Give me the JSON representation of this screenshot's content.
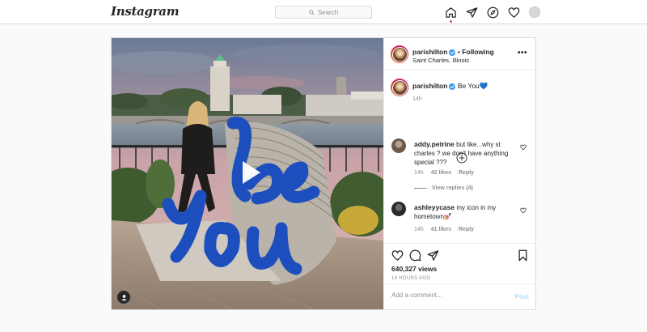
{
  "nav": {
    "logo": "Instagram",
    "search_placeholder": "Search",
    "icons": [
      "home-icon",
      "direct-icon",
      "explore-icon",
      "activity-heart-icon",
      "profile-avatar"
    ]
  },
  "post": {
    "username": "parishilton",
    "separator": "•",
    "follow_status": "Following",
    "location": "Saint Charles, Illinois",
    "more": "•••",
    "caption_text": "Be You",
    "caption_emoji": "💙",
    "caption_time": "14h",
    "comments": [
      {
        "username": "addy.petrine",
        "text": "but like...why st charles ? we don't have anything special ???",
        "time": "14h",
        "likes": "42 likes",
        "reply": "Reply",
        "view_replies": "View replies (4)"
      },
      {
        "username": "ashleyycase",
        "text": "my icon in my hometown",
        "emoji": "💅🏼",
        "time": "14h",
        "likes": "41 likes",
        "reply": "Reply"
      }
    ],
    "views": "640,327 views",
    "ago": "14 HOURS AGO",
    "add_comment_placeholder": "Add a comment...",
    "post_button": "Post"
  },
  "colors": {
    "verified": "#3897f0",
    "sculpture": "#1c4fbd",
    "post_button_disabled": "#b2dffc",
    "notification_dot": "#ed4956"
  }
}
